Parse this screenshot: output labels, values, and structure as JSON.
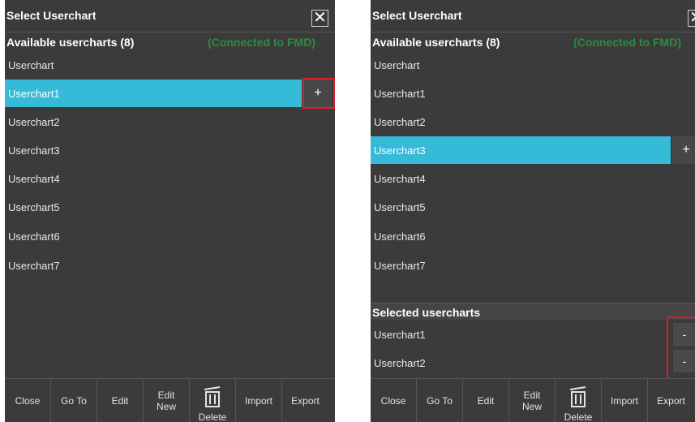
{
  "left": {
    "title": "Select Userchart",
    "available_label": "Available usercharts (8)",
    "status": "(Connected to FMD)",
    "items": [
      "Userchart",
      "Userchart1",
      "Userchart2",
      "Userchart3",
      "Userchart4",
      "Userchart5",
      "Userchart6",
      "Userchart7"
    ],
    "selected_index": 1,
    "plus": "+"
  },
  "right": {
    "title": "Select Userchart",
    "available_label": "Available usercharts (8)",
    "status": "(Connected to FMD)",
    "items": [
      "Userchart",
      "Userchart1",
      "Userchart2",
      "Userchart3",
      "Userchart4",
      "Userchart5",
      "Userchart6",
      "Userchart7"
    ],
    "selected_index": 3,
    "plus": "+",
    "selected_label": "Selected usercharts",
    "selected_items": [
      "Userchart1",
      "Userchart2"
    ],
    "minus": "-"
  },
  "toolbar": {
    "close": "Close",
    "goto": "Go To",
    "edit": "Edit",
    "edit_new_1": "Edit",
    "edit_new_2": "New",
    "delete": "Delete",
    "import": "Import",
    "export": "Export"
  },
  "colors": {
    "selected_row": "#35bad8",
    "highlight_box": "#e21c26",
    "status_green": "#2e8b3d",
    "panel_bg": "#3b3b3b"
  }
}
